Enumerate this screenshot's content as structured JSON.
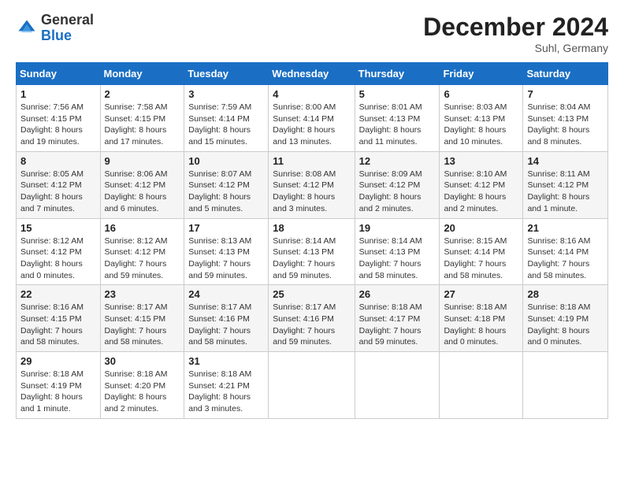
{
  "header": {
    "logo_general": "General",
    "logo_blue": "Blue",
    "month_title": "December 2024",
    "location": "Suhl, Germany"
  },
  "days_of_week": [
    "Sunday",
    "Monday",
    "Tuesday",
    "Wednesday",
    "Thursday",
    "Friday",
    "Saturday"
  ],
  "weeks": [
    [
      {
        "day": "1",
        "sunrise": "7:56 AM",
        "sunset": "4:15 PM",
        "daylight": "8 hours and 19 minutes."
      },
      {
        "day": "2",
        "sunrise": "7:58 AM",
        "sunset": "4:15 PM",
        "daylight": "8 hours and 17 minutes."
      },
      {
        "day": "3",
        "sunrise": "7:59 AM",
        "sunset": "4:14 PM",
        "daylight": "8 hours and 15 minutes."
      },
      {
        "day": "4",
        "sunrise": "8:00 AM",
        "sunset": "4:14 PM",
        "daylight": "8 hours and 13 minutes."
      },
      {
        "day": "5",
        "sunrise": "8:01 AM",
        "sunset": "4:13 PM",
        "daylight": "8 hours and 11 minutes."
      },
      {
        "day": "6",
        "sunrise": "8:03 AM",
        "sunset": "4:13 PM",
        "daylight": "8 hours and 10 minutes."
      },
      {
        "day": "7",
        "sunrise": "8:04 AM",
        "sunset": "4:13 PM",
        "daylight": "8 hours and 8 minutes."
      }
    ],
    [
      {
        "day": "8",
        "sunrise": "8:05 AM",
        "sunset": "4:12 PM",
        "daylight": "8 hours and 7 minutes."
      },
      {
        "day": "9",
        "sunrise": "8:06 AM",
        "sunset": "4:12 PM",
        "daylight": "8 hours and 6 minutes."
      },
      {
        "day": "10",
        "sunrise": "8:07 AM",
        "sunset": "4:12 PM",
        "daylight": "8 hours and 5 minutes."
      },
      {
        "day": "11",
        "sunrise": "8:08 AM",
        "sunset": "4:12 PM",
        "daylight": "8 hours and 3 minutes."
      },
      {
        "day": "12",
        "sunrise": "8:09 AM",
        "sunset": "4:12 PM",
        "daylight": "8 hours and 2 minutes."
      },
      {
        "day": "13",
        "sunrise": "8:10 AM",
        "sunset": "4:12 PM",
        "daylight": "8 hours and 2 minutes."
      },
      {
        "day": "14",
        "sunrise": "8:11 AM",
        "sunset": "4:12 PM",
        "daylight": "8 hours and 1 minute."
      }
    ],
    [
      {
        "day": "15",
        "sunrise": "8:12 AM",
        "sunset": "4:12 PM",
        "daylight": "8 hours and 0 minutes."
      },
      {
        "day": "16",
        "sunrise": "8:12 AM",
        "sunset": "4:12 PM",
        "daylight": "7 hours and 59 minutes."
      },
      {
        "day": "17",
        "sunrise": "8:13 AM",
        "sunset": "4:13 PM",
        "daylight": "7 hours and 59 minutes."
      },
      {
        "day": "18",
        "sunrise": "8:14 AM",
        "sunset": "4:13 PM",
        "daylight": "7 hours and 59 minutes."
      },
      {
        "day": "19",
        "sunrise": "8:14 AM",
        "sunset": "4:13 PM",
        "daylight": "7 hours and 58 minutes."
      },
      {
        "day": "20",
        "sunrise": "8:15 AM",
        "sunset": "4:14 PM",
        "daylight": "7 hours and 58 minutes."
      },
      {
        "day": "21",
        "sunrise": "8:16 AM",
        "sunset": "4:14 PM",
        "daylight": "7 hours and 58 minutes."
      }
    ],
    [
      {
        "day": "22",
        "sunrise": "8:16 AM",
        "sunset": "4:15 PM",
        "daylight": "7 hours and 58 minutes."
      },
      {
        "day": "23",
        "sunrise": "8:17 AM",
        "sunset": "4:15 PM",
        "daylight": "7 hours and 58 minutes."
      },
      {
        "day": "24",
        "sunrise": "8:17 AM",
        "sunset": "4:16 PM",
        "daylight": "7 hours and 58 minutes."
      },
      {
        "day": "25",
        "sunrise": "8:17 AM",
        "sunset": "4:16 PM",
        "daylight": "7 hours and 59 minutes."
      },
      {
        "day": "26",
        "sunrise": "8:18 AM",
        "sunset": "4:17 PM",
        "daylight": "7 hours and 59 minutes."
      },
      {
        "day": "27",
        "sunrise": "8:18 AM",
        "sunset": "4:18 PM",
        "daylight": "8 hours and 0 minutes."
      },
      {
        "day": "28",
        "sunrise": "8:18 AM",
        "sunset": "4:19 PM",
        "daylight": "8 hours and 0 minutes."
      }
    ],
    [
      {
        "day": "29",
        "sunrise": "8:18 AM",
        "sunset": "4:19 PM",
        "daylight": "8 hours and 1 minute."
      },
      {
        "day": "30",
        "sunrise": "8:18 AM",
        "sunset": "4:20 PM",
        "daylight": "8 hours and 2 minutes."
      },
      {
        "day": "31",
        "sunrise": "8:18 AM",
        "sunset": "4:21 PM",
        "daylight": "8 hours and 3 minutes."
      },
      null,
      null,
      null,
      null
    ]
  ],
  "labels": {
    "sunrise": "Sunrise:",
    "sunset": "Sunset:",
    "daylight": "Daylight:"
  }
}
